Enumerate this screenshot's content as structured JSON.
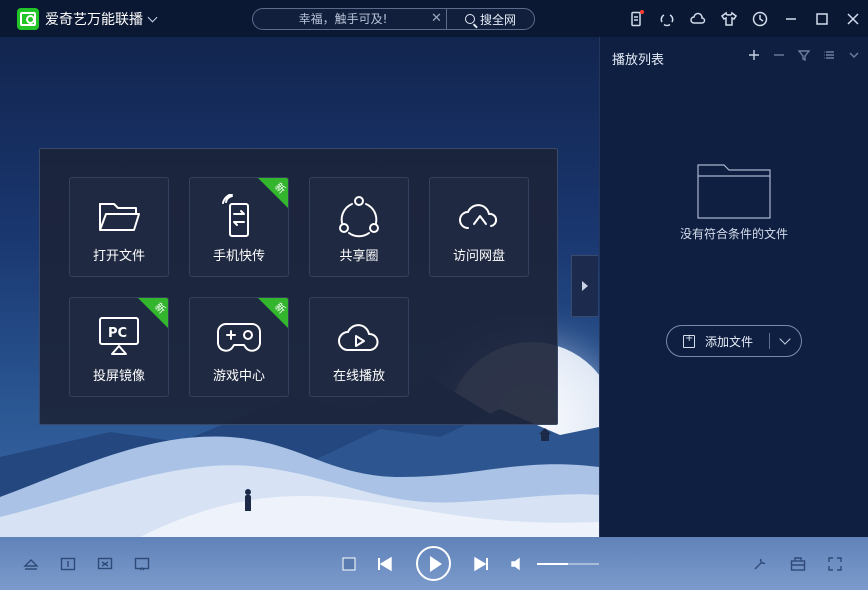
{
  "app": {
    "title": "爱奇艺万能联播",
    "logo_icon": "iqiyi-logo-icon"
  },
  "search": {
    "placeholder": "幸福，触手可及!",
    "button_label": "搜全网",
    "clear_icon": "close-icon"
  },
  "toolbar_icons": [
    "phone-sync-icon",
    "share-circle-icon",
    "cloud-icon",
    "skin-shirt-icon",
    "history-clock-icon",
    "minimize-icon",
    "maximize-icon",
    "close-icon"
  ],
  "launcher": {
    "tiles": [
      {
        "label": "打开文件",
        "icon": "folder-open-icon",
        "badge": ""
      },
      {
        "label": "手机快传",
        "icon": "phone-transfer-icon",
        "badge": "新"
      },
      {
        "label": "共享圈",
        "icon": "share-circle-icon",
        "badge": ""
      },
      {
        "label": "访问网盘",
        "icon": "cloud-drive-icon",
        "badge": ""
      },
      {
        "label": "投屏镜像",
        "icon": "pc-cast-icon",
        "badge": "新"
      },
      {
        "label": "游戏中心",
        "icon": "gamepad-icon",
        "badge": "新"
      },
      {
        "label": "在线播放",
        "icon": "cloud-play-icon",
        "badge": ""
      }
    ]
  },
  "playlist": {
    "title": "播放列表",
    "empty_text": "没有符合条件的文件",
    "add_file_label": "添加文件"
  },
  "player": {
    "volume_level": 0.5
  },
  "colors": {
    "accent_green": "#22c528",
    "badge_green": "#33b52e",
    "titlebar_bg": "#0b1833",
    "panel_bg": "#1c243a"
  }
}
